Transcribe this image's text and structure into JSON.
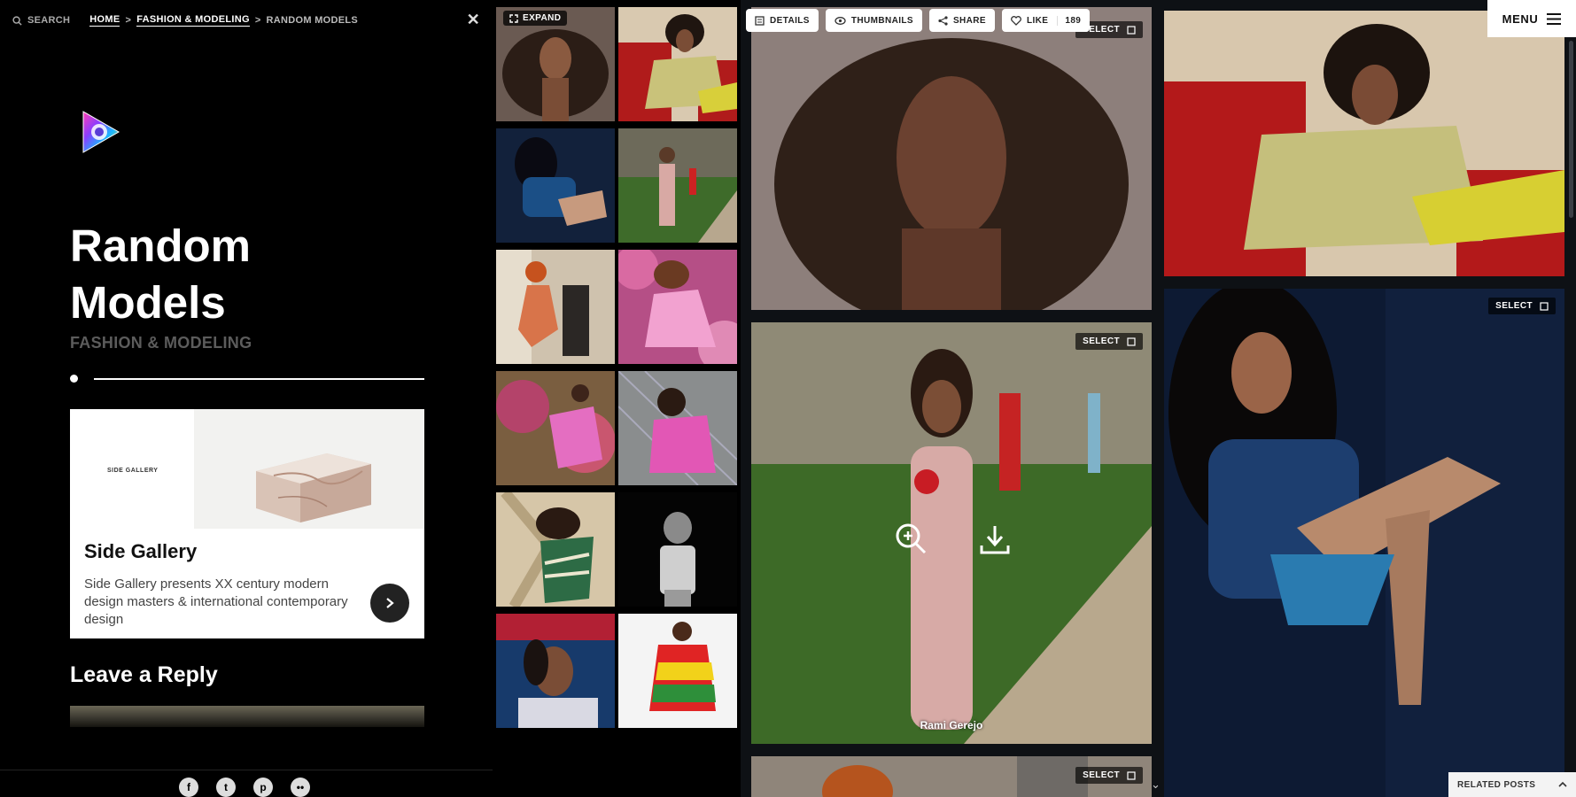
{
  "topbar": {
    "search_label": "SEARCH",
    "breadcrumb": [
      "HOME",
      "FASHION & MODELING",
      "RANDOM MODELS"
    ],
    "separator": ">"
  },
  "sidebar": {
    "title_line1": "Random",
    "title_line2": "Models",
    "category": "FASHION & MODELING",
    "ad": {
      "brand": "SIDE GALLERY",
      "title": "Side Gallery",
      "body": "Side Gallery presents XX century modern design masters & international contemporary design"
    },
    "reply_heading": "Leave a Reply",
    "social_icons": [
      "facebook-icon",
      "twitter-icon",
      "pinterest-icon",
      "flickr-icon"
    ]
  },
  "thumbs": {
    "expand_label": "EXPAND",
    "count": 12
  },
  "toolbar": {
    "details": "DETAILS",
    "thumbnails": "THUMBNAILS",
    "share": "SHARE",
    "like": "LIKE",
    "like_count": "189"
  },
  "menu": {
    "label": "MENU"
  },
  "gallery": {
    "select_label": "SELECT",
    "caption": "Rami Gerejo"
  },
  "related": {
    "label": "RELATED POSTS"
  },
  "colors": {
    "background": "#000000",
    "gallery_bg": "#0e1115",
    "accent_ad": "#2aa6e0"
  }
}
